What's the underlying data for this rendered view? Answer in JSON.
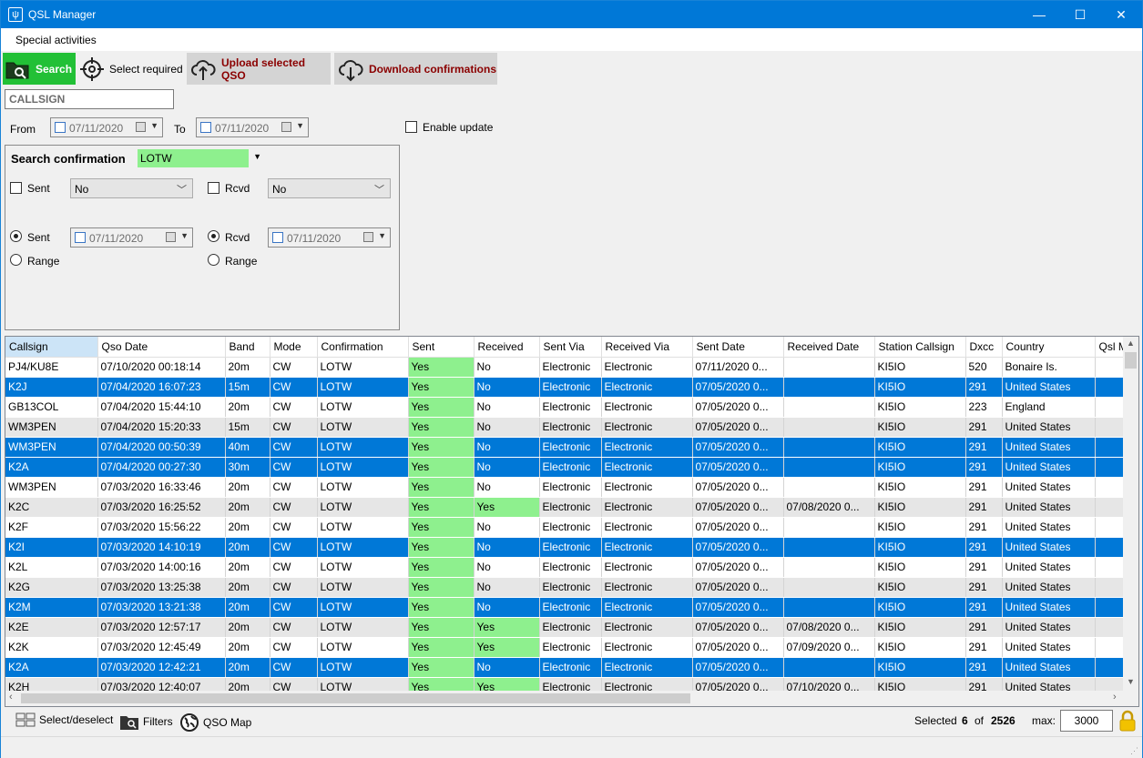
{
  "window": {
    "title": "QSL Manager",
    "min_glyph": "—",
    "max_glyph": "☐",
    "close_glyph": "✕"
  },
  "menu": {
    "items": [
      "Special activities"
    ]
  },
  "toolbar": {
    "search_label": "Search",
    "select_required_label": "Select required",
    "upload_label": "Upload selected QSO",
    "download_label": "Download confirmations"
  },
  "search": {
    "callsign_placeholder": "CALLSIGN"
  },
  "date_range": {
    "from_label": "From",
    "from_value": "07/11/2020",
    "to_label": "To",
    "to_value": "07/11/2020",
    "enable_update_label": "Enable update"
  },
  "confirmation": {
    "title": "Search confirmation",
    "method": "LOTW",
    "sent_label": "Sent",
    "sent_value": "No",
    "rcvd_label": "Rcvd",
    "rcvd_value": "No",
    "sent_date_label": "Sent",
    "sent_date": "07/11/2020",
    "rcvd_date_label": "Rcvd",
    "rcvd_date": "07/11/2020",
    "range_label": "Range"
  },
  "grid": {
    "columns": [
      "Callsign",
      "Qso Date",
      "Band",
      "Mode",
      "Confirmation",
      "Sent",
      "Received",
      "Sent Via",
      "Received Via",
      "Sent Date",
      "Received Date",
      "Station Callsign",
      "Dxcc",
      "Country",
      "Qsl M"
    ],
    "rows": [
      {
        "style": "",
        "cells": [
          "PJ4/KU8E",
          "07/10/2020 00:18:14",
          "20m",
          "CW",
          "LOTW",
          "Yes",
          "No",
          "Electronic",
          "Electronic",
          "07/11/2020 0...",
          "",
          "KI5IO",
          "520",
          "Bonaire Is.",
          ""
        ],
        "green_received": false
      },
      {
        "style": "sel",
        "cells": [
          "K2J",
          "07/04/2020 16:07:23",
          "15m",
          "CW",
          "LOTW",
          "Yes",
          "No",
          "Electronic",
          "Electronic",
          "07/05/2020 0...",
          "",
          "KI5IO",
          "291",
          "United States",
          ""
        ],
        "green_received": false
      },
      {
        "style": "",
        "cells": [
          "GB13COL",
          "07/04/2020 15:44:10",
          "20m",
          "CW",
          "LOTW",
          "Yes",
          "No",
          "Electronic",
          "Electronic",
          "07/05/2020 0...",
          "",
          "KI5IO",
          "223",
          "England",
          ""
        ],
        "green_received": false
      },
      {
        "style": "alt",
        "cells": [
          "WM3PEN",
          "07/04/2020 15:20:33",
          "15m",
          "CW",
          "LOTW",
          "Yes",
          "No",
          "Electronic",
          "Electronic",
          "07/05/2020 0...",
          "",
          "KI5IO",
          "291",
          "United States",
          ""
        ],
        "green_received": false
      },
      {
        "style": "sel",
        "cells": [
          "WM3PEN",
          "07/04/2020 00:50:39",
          "40m",
          "CW",
          "LOTW",
          "Yes",
          "No",
          "Electronic",
          "Electronic",
          "07/05/2020 0...",
          "",
          "KI5IO",
          "291",
          "United States",
          ""
        ],
        "green_received": false
      },
      {
        "style": "sel",
        "cells": [
          "K2A",
          "07/04/2020 00:27:30",
          "30m",
          "CW",
          "LOTW",
          "Yes",
          "No",
          "Electronic",
          "Electronic",
          "07/05/2020 0...",
          "",
          "KI5IO",
          "291",
          "United States",
          ""
        ],
        "green_received": false
      },
      {
        "style": "",
        "cells": [
          "WM3PEN",
          "07/03/2020 16:33:46",
          "20m",
          "CW",
          "LOTW",
          "Yes",
          "No",
          "Electronic",
          "Electronic",
          "07/05/2020 0...",
          "",
          "KI5IO",
          "291",
          "United States",
          ""
        ],
        "green_received": false
      },
      {
        "style": "alt",
        "cells": [
          "K2C",
          "07/03/2020 16:25:52",
          "20m",
          "CW",
          "LOTW",
          "Yes",
          "Yes",
          "Electronic",
          "Electronic",
          "07/05/2020 0...",
          "07/08/2020 0...",
          "KI5IO",
          "291",
          "United States",
          ""
        ],
        "green_received": true
      },
      {
        "style": "",
        "cells": [
          "K2F",
          "07/03/2020 15:56:22",
          "20m",
          "CW",
          "LOTW",
          "Yes",
          "No",
          "Electronic",
          "Electronic",
          "07/05/2020 0...",
          "",
          "KI5IO",
          "291",
          "United States",
          ""
        ],
        "green_received": false
      },
      {
        "style": "sel",
        "cells": [
          "K2I",
          "07/03/2020 14:10:19",
          "20m",
          "CW",
          "LOTW",
          "Yes",
          "No",
          "Electronic",
          "Electronic",
          "07/05/2020 0...",
          "",
          "KI5IO",
          "291",
          "United States",
          ""
        ],
        "green_received": false
      },
      {
        "style": "",
        "cells": [
          "K2L",
          "07/03/2020 14:00:16",
          "20m",
          "CW",
          "LOTW",
          "Yes",
          "No",
          "Electronic",
          "Electronic",
          "07/05/2020 0...",
          "",
          "KI5IO",
          "291",
          "United States",
          ""
        ],
        "green_received": false
      },
      {
        "style": "alt",
        "cells": [
          "K2G",
          "07/03/2020 13:25:38",
          "20m",
          "CW",
          "LOTW",
          "Yes",
          "No",
          "Electronic",
          "Electronic",
          "07/05/2020 0...",
          "",
          "KI5IO",
          "291",
          "United States",
          ""
        ],
        "green_received": false
      },
      {
        "style": "sel",
        "cells": [
          "K2M",
          "07/03/2020 13:21:38",
          "20m",
          "CW",
          "LOTW",
          "Yes",
          "No",
          "Electronic",
          "Electronic",
          "07/05/2020 0...",
          "",
          "KI5IO",
          "291",
          "United States",
          ""
        ],
        "green_received": false
      },
      {
        "style": "alt",
        "cells": [
          "K2E",
          "07/03/2020 12:57:17",
          "20m",
          "CW",
          "LOTW",
          "Yes",
          "Yes",
          "Electronic",
          "Electronic",
          "07/05/2020 0...",
          "07/08/2020 0...",
          "KI5IO",
          "291",
          "United States",
          ""
        ],
        "green_received": true
      },
      {
        "style": "",
        "cells": [
          "K2K",
          "07/03/2020 12:45:49",
          "20m",
          "CW",
          "LOTW",
          "Yes",
          "Yes",
          "Electronic",
          "Electronic",
          "07/05/2020 0...",
          "07/09/2020 0...",
          "KI5IO",
          "291",
          "United States",
          ""
        ],
        "green_received": true
      },
      {
        "style": "sel",
        "cells": [
          "K2A",
          "07/03/2020 12:42:21",
          "20m",
          "CW",
          "LOTW",
          "Yes",
          "No",
          "Electronic",
          "Electronic",
          "07/05/2020 0...",
          "",
          "KI5IO",
          "291",
          "United States",
          ""
        ],
        "green_received": false
      },
      {
        "style": "alt",
        "cells": [
          "K2H",
          "07/03/2020 12:40:07",
          "20m",
          "CW",
          "LOTW",
          "Yes",
          "Yes",
          "Electronic",
          "Electronic",
          "07/05/2020 0...",
          "07/10/2020 0...",
          "KI5IO",
          "291",
          "United States",
          ""
        ],
        "green_received": true
      }
    ]
  },
  "status": {
    "select_deselect_label": "Select/deselect",
    "filters_label": "Filters",
    "qso_map_label": "QSO Map",
    "selected_label": "Selected",
    "selected_count": "6",
    "of_label": "of",
    "total_count": "2526",
    "max_label": "max:",
    "max_value": "3000"
  },
  "colors": {
    "accent": "#0078d7",
    "green": "#8ef08e",
    "search_green": "#22c036",
    "action_text": "#8b0000"
  }
}
